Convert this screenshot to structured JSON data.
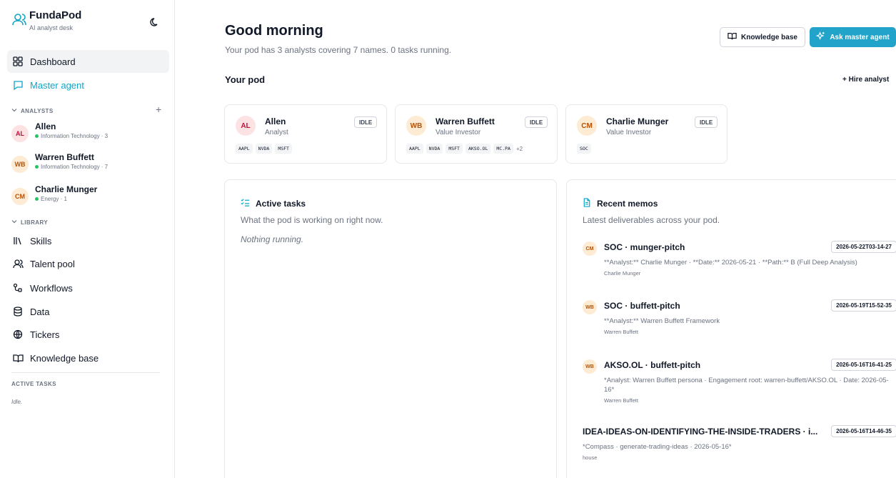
{
  "brand": {
    "name": "FundaPod",
    "subtitle": "AI analyst desk"
  },
  "nav": {
    "dashboard": "Dashboard",
    "master_agent": "Master agent"
  },
  "analysts_section": {
    "label": "ANALYSTS"
  },
  "analysts": [
    {
      "initials": "AL",
      "name": "Allen",
      "sector": "Information Technology · 3"
    },
    {
      "initials": "WB",
      "name": "Warren Buffett",
      "sector": "Information Technology · 7"
    },
    {
      "initials": "CM",
      "name": "Charlie Munger",
      "sector": "Energy · 1"
    }
  ],
  "library_section": {
    "label": "LIBRARY"
  },
  "library": {
    "skills": "Skills",
    "talent_pool": "Talent pool",
    "workflows": "Workflows",
    "data": "Data",
    "tickers": "Tickers",
    "knowledge_base": "Knowledge base"
  },
  "sidebar_tasks": {
    "label": "ACTIVE TASKS",
    "status": "Idle."
  },
  "header": {
    "greeting": "Good morning",
    "summary": "Your pod has 3 analysts covering 7 names. 0 tasks running.",
    "kb_button": "Knowledge base",
    "ask_button": "Ask master agent"
  },
  "pod": {
    "title": "Your pod",
    "hire": "+ Hire analyst",
    "cards": [
      {
        "initials": "AL",
        "name": "Allen",
        "role": "Analyst",
        "status": "IDLE",
        "tickers": [
          "AAPL",
          "NVDA",
          "MSFT"
        ],
        "more": ""
      },
      {
        "initials": "WB",
        "name": "Warren Buffett",
        "role": "Value Investor",
        "status": "IDLE",
        "tickers": [
          "AAPL",
          "NVDA",
          "MSFT",
          "AKSO.OL",
          "MC.PA"
        ],
        "more": "+2"
      },
      {
        "initials": "CM",
        "name": "Charlie Munger",
        "role": "Value Investor",
        "status": "IDLE",
        "tickers": [
          "SOC"
        ],
        "more": ""
      }
    ]
  },
  "active_tasks": {
    "title": "Active tasks",
    "subtitle": "What the pod is working on right now.",
    "empty": "Nothing running."
  },
  "recent_memos": {
    "title": "Recent memos",
    "subtitle": "Latest deliverables across your pod.",
    "items": [
      {
        "initials": "CM",
        "title": "SOC · munger-pitch",
        "date": "2026-05-22T03-14-27",
        "body": "**Analyst:** Charlie Munger · **Date:** 2026-05-21 · **Path:** B (Full Deep Analysis)",
        "author": "Charlie Munger"
      },
      {
        "initials": "WB",
        "title": "SOC · buffett-pitch",
        "date": "2026-05-19T15-52-35",
        "body": "**Analyst:** Warren Buffett Framework",
        "author": "Warren Buffett"
      },
      {
        "initials": "WB",
        "title": "AKSO.OL · buffett-pitch",
        "date": "2026-05-16T16-41-25",
        "body": "*Analyst: Warren Buffett persona · Engagement root: warren-buffett/AKSO.OL · Date: 2026-05-16*",
        "author": "Warren Buffett"
      },
      {
        "initials": "",
        "title": "IDEA-IDEAS-ON-IDENTIFYING-THE-INSIDE-TRADERS · i...",
        "date": "2026-05-16T14-46-35",
        "body": "*Compass · generate-trading-ideas · 2026-05-16*",
        "author": "house"
      }
    ]
  },
  "colors": {
    "accent": "#22a3c9",
    "nav_accent": "#0ea5c9",
    "status_dot": "#22c55e"
  }
}
